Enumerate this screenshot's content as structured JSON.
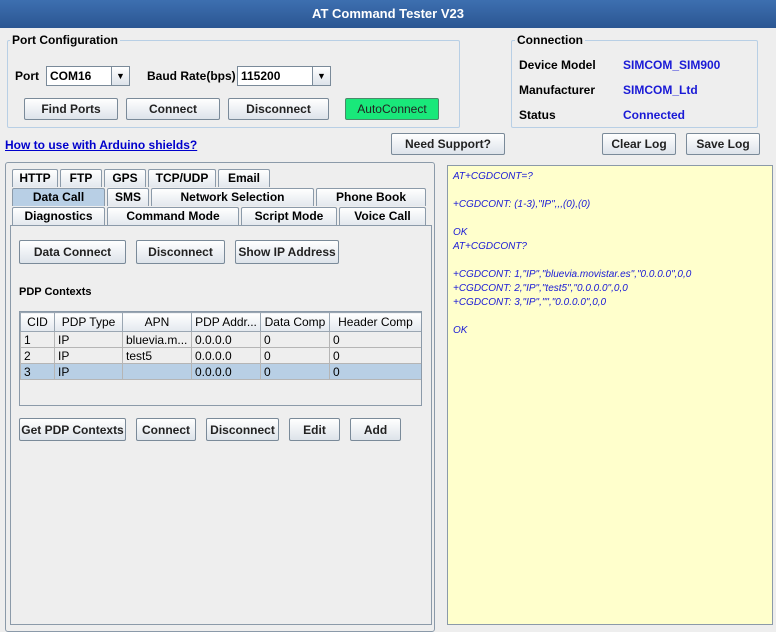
{
  "window": {
    "title": "AT Command Tester V23"
  },
  "port_config": {
    "legend": "Port Configuration",
    "port_label": "Port",
    "port_value": "COM16",
    "baud_label": "Baud Rate(bps)",
    "baud_value": "115200",
    "find_ports": "Find Ports",
    "connect": "Connect",
    "disconnect": "Disconnect",
    "autoconnect": "AutoConnect",
    "autoconnect_color": "#19e87a"
  },
  "connection": {
    "legend": "Connection",
    "device_model_label": "Device Model",
    "device_model_value": "SIMCOM_SIM900",
    "manufacturer_label": "Manufacturer",
    "manufacturer_value": "SIMCOM_Ltd",
    "status_label": "Status",
    "status_value": "Connected",
    "value_color": "#1a1ad6"
  },
  "toolbar": {
    "howto_link": "How to use with Arduino shields?",
    "need_support": "Need Support?",
    "clear_log": "Clear Log",
    "save_log": "Save Log"
  },
  "tabs": {
    "row1": [
      "HTTP",
      "FTP",
      "GPS",
      "TCP/UDP",
      "Email"
    ],
    "row2": [
      "Data Call",
      "SMS",
      "Network Selection",
      "Phone Book"
    ],
    "row3": [
      "Diagnostics",
      "Command Mode",
      "Script Mode",
      "Voice Call"
    ],
    "selected": "Data Call"
  },
  "data_call": {
    "data_connect": "Data Connect",
    "disconnect": "Disconnect",
    "show_ip": "Show IP Address",
    "pdp_title": "PDP Contexts",
    "columns": [
      "CID",
      "PDP Type",
      "APN",
      "PDP Addr...",
      "Data Comp",
      "Header Comp"
    ],
    "rows": [
      [
        "1",
        "IP",
        "bluevia.m...",
        "0.0.0.0",
        "0",
        "0"
      ],
      [
        "2",
        "IP",
        "test5",
        "0.0.0.0",
        "0",
        "0"
      ],
      [
        "3",
        "IP",
        "",
        "0.0.0.0",
        "0",
        "0"
      ]
    ],
    "selected_row": 2,
    "get_pdp": "Get PDP Contexts",
    "connect": "Connect",
    "disconnect2": "Disconnect",
    "edit": "Edit",
    "add": "Add"
  },
  "log": {
    "lines": [
      "AT+CGDCONT=?",
      "",
      "+CGDCONT: (1-3),\"IP\",,,(0),(0)",
      "",
      "OK",
      "AT+CGDCONT?",
      "",
      "+CGDCONT: 1,\"IP\",\"bluevia.movistar.es\",\"0.0.0.0\",0,0",
      "+CGDCONT: 2,\"IP\",\"test5\",\"0.0.0.0\",0,0",
      "+CGDCONT: 3,\"IP\",\"\",\"0.0.0.0\",0,0",
      "",
      "OK"
    ],
    "background": "#ffffcc"
  }
}
